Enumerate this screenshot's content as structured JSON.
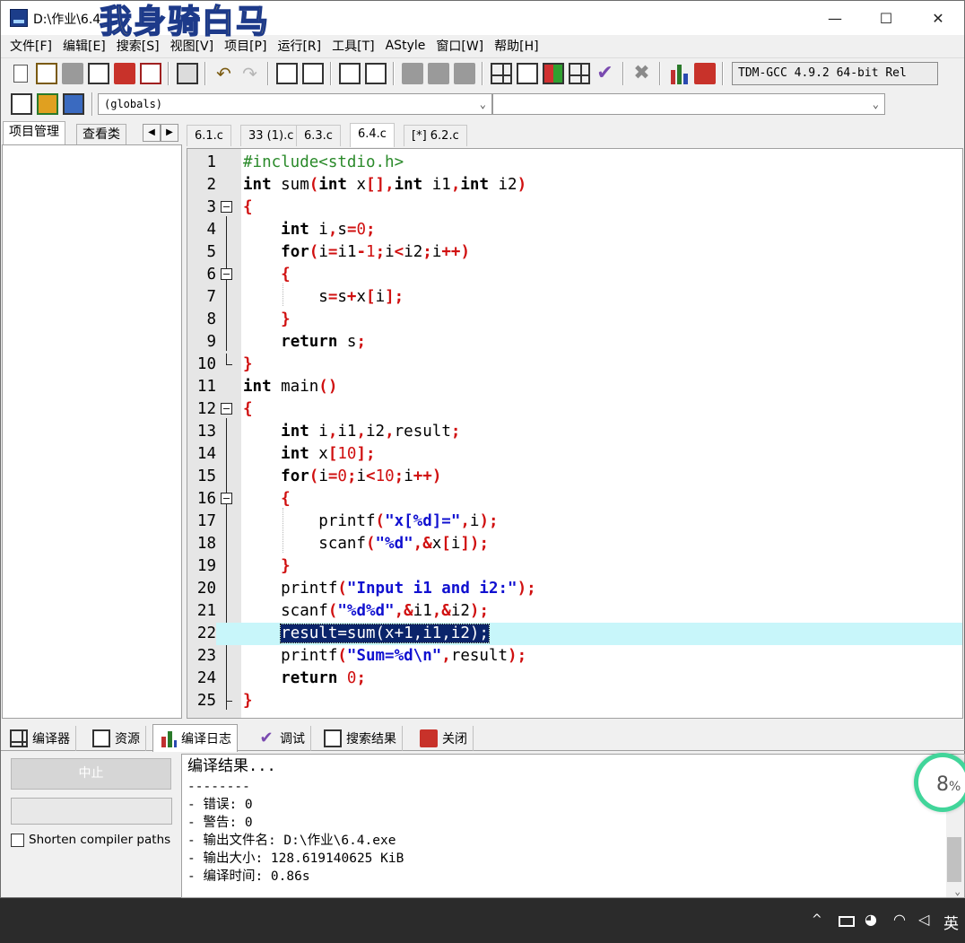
{
  "window": {
    "title": "D:\\作业\\6.4",
    "watermark": "我身骑白马",
    "controls": {
      "minimize": "—",
      "maximize": "☐",
      "close": "✕"
    }
  },
  "menu": [
    "文件[F]",
    "编辑[E]",
    "搜索[S]",
    "视图[V]",
    "项目[P]",
    "运行[R]",
    "工具[T]",
    "AStyle",
    "窗口[W]",
    "帮助[H]"
  ],
  "toolbar": {
    "compiler": "TDM-GCC 4.9.2 64-bit Rel"
  },
  "scope_combo": {
    "left": "(globals)",
    "right": ""
  },
  "left_tabs": [
    "项目管理",
    "查看类"
  ],
  "editor_tabs": [
    "6.1.c",
    "33 (1).c",
    "6.3.c",
    "6.4.c",
    "[*] 6.2.c"
  ],
  "active_editor_tab": "6.4.c",
  "code": {
    "line_numbers": [
      "1",
      "2",
      "3",
      "4",
      "5",
      "6",
      "7",
      "8",
      "9",
      "10",
      "11",
      "12",
      "13",
      "14",
      "15",
      "16",
      "17",
      "18",
      "19",
      "20",
      "21",
      "22",
      "23",
      "24",
      "25"
    ],
    "highlighted_line": 22,
    "selection": "result=sum(x+1,i1,i2);"
  },
  "bottom_tabs": [
    "编译器",
    "资源",
    "编译日志",
    "调试",
    "搜索结果",
    "关闭"
  ],
  "active_bottom_tab": "编译日志",
  "compile_panel": {
    "abort_label": "中止",
    "shorten_label": "Shorten compiler paths",
    "log": [
      "编译结果...",
      "--------",
      "- 错误: 0",
      "- 警告: 0",
      "- 输出文件名: D:\\作业\\6.4.exe",
      "- 输出大小: 128.619140625 KiB",
      "- 编译时间: 0.86s"
    ]
  },
  "badge": {
    "value": "8",
    "unit": "%"
  },
  "taskbar": {
    "ime": "英",
    "chevron": "^"
  },
  "colors": {
    "keyword": "#000000",
    "string": "#1010d0",
    "operator": "#d01010",
    "preprocessor": "#2a8a2a",
    "current_line": "#c8f6fa",
    "selection": "#0a246a"
  }
}
